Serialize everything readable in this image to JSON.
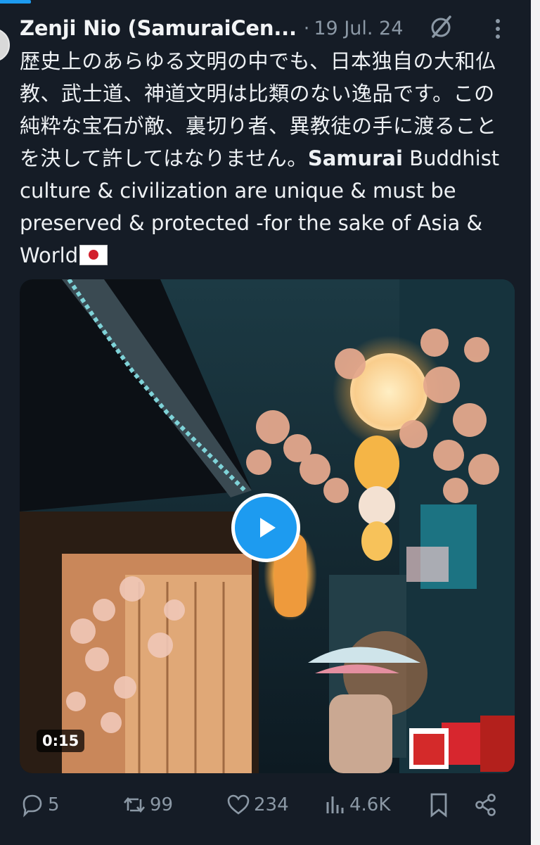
{
  "post": {
    "author": "Zenji Nio (SamuraiCen...",
    "separator": "·",
    "date": "19 Jul. 24",
    "text_jp": "歴史上のあらゆる文明の中でも、日本独自の大和仏教、武士道、神道文明は比類のない逸品です。この純粋な宝石が敵、裏切り者、異教徒の手に渡ることを決して許してはなりません。",
    "text_bold": "Samurai",
    "text_en": " Buddhist culture & civilization are unique & must be preserved & protected -for the sake of Asia & World",
    "flag_icon": "japan-flag-icon"
  },
  "media": {
    "type": "video",
    "duration": "0:15",
    "play_icon": "play-icon",
    "description_colors": {
      "lantern": "#f3b04a",
      "leaves": "#e8a68a",
      "teal": "#2e8c96"
    }
  },
  "actions": {
    "replies": "5",
    "reposts": "99",
    "likes": "234",
    "views": "4.6K"
  },
  "theme": {
    "background": "#151c26",
    "text": "#eef1f4",
    "muted": "#8b98a5",
    "accent": "#1d9bf0"
  }
}
